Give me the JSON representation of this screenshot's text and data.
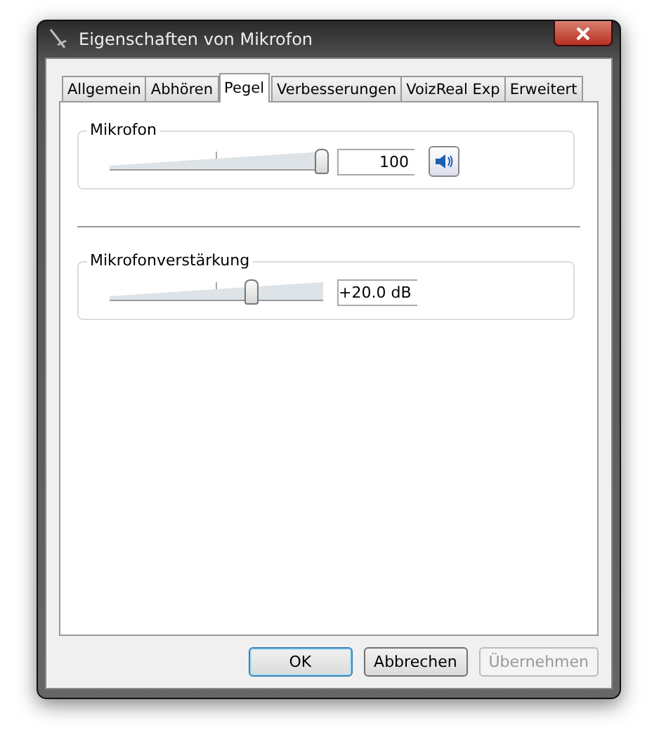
{
  "window": {
    "title": "Eigenschaften von Mikrofon"
  },
  "tabs": [
    {
      "label": "Allgemein",
      "selected": false
    },
    {
      "label": "Abhören",
      "selected": false
    },
    {
      "label": "Pegel",
      "selected": true
    },
    {
      "label": "Verbesserungen",
      "selected": false
    },
    {
      "label": "VoizReal Exp",
      "selected": false
    },
    {
      "label": "Erweitert",
      "selected": false
    }
  ],
  "groups": [
    {
      "title": "Mikrofon",
      "level": 1.0,
      "reading": "100",
      "mute_button": true
    },
    {
      "title": "Mikrofonverstärkung",
      "level": 0.66,
      "reading": "+20.0 dB",
      "mute_button": false
    }
  ],
  "buttons": [
    {
      "label": "OK",
      "default": true,
      "disabled": false
    },
    {
      "label": "Abbrechen",
      "default": false,
      "disabled": false
    },
    {
      "label": "Übernehmen",
      "default": false,
      "disabled": true
    }
  ]
}
